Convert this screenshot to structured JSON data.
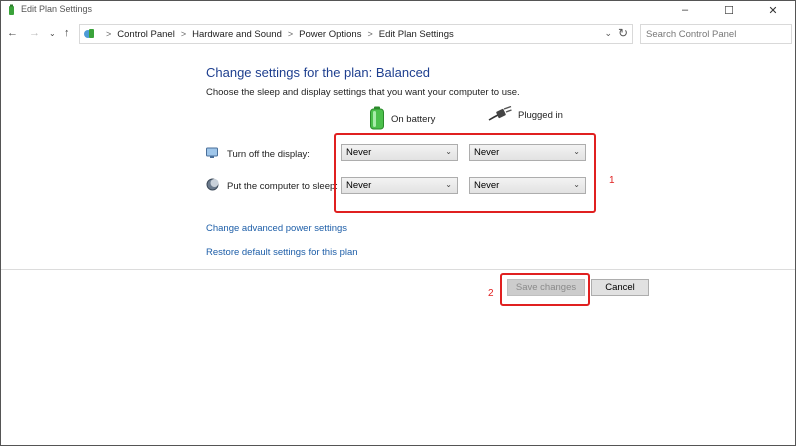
{
  "window": {
    "title": "Edit Plan Settings"
  },
  "address_bar": {
    "breadcrumbs": [
      "Control Panel",
      "Hardware and Sound",
      "Power Options",
      "Edit Plan Settings"
    ],
    "search_placeholder": "Search Control Panel"
  },
  "content": {
    "title": "Change settings for the plan: Balanced",
    "subtitle": "Choose the sleep and display settings that you want your computer to use.",
    "columns": {
      "on_battery": "On battery",
      "plugged_in": "Plugged in"
    },
    "rows": [
      {
        "label": "Turn off the display:",
        "battery": "Never",
        "plugged": "Never"
      },
      {
        "label": "Put the computer to sleep:",
        "battery": "Never",
        "plugged": "Never"
      }
    ],
    "links": {
      "advanced": "Change advanced power settings",
      "restore": "Restore default settings for this plan"
    }
  },
  "buttons": {
    "save": "Save changes",
    "cancel": "Cancel"
  },
  "annotations": {
    "one": "1",
    "two": "2"
  },
  "colors": {
    "annotation": "#e02020",
    "title": "#1e3f8f",
    "link": "#1d5ea8"
  }
}
